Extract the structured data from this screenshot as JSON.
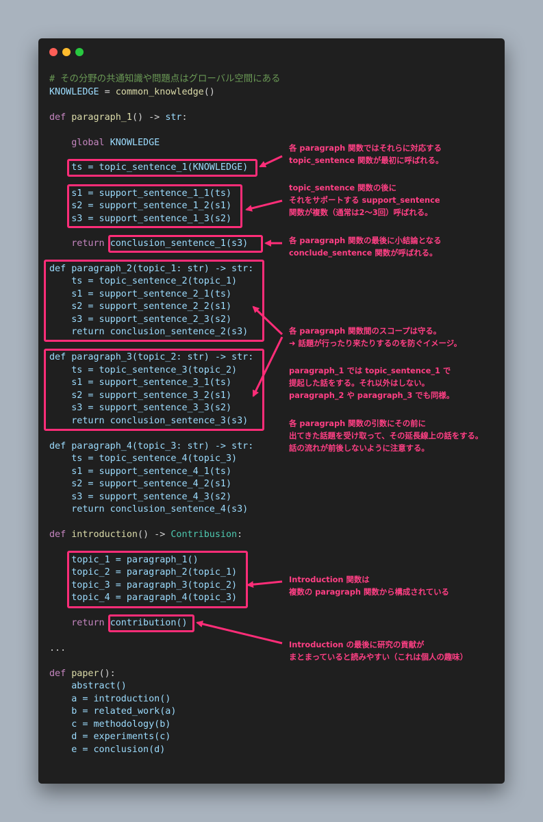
{
  "window": {
    "controls": [
      "close",
      "minimize",
      "maximize"
    ],
    "accent": "#ff2d78"
  },
  "code": {
    "comment": "# その分野の共通知識や問題点はグローバル空間にある",
    "knowledge_var": "KNOWLEDGE",
    "knowledge_fn": "common_knowledge",
    "p1_name": "paragraph_1",
    "p1_ret": "str",
    "global_kw": "global",
    "ts1": "ts = topic_sentence_1(KNOWLEDGE)",
    "s1_1": "s1 = support_sentence_1_1(ts)",
    "s1_2": "s2 = support_sentence_1_2(s1)",
    "s1_3": "s3 = support_sentence_1_3(s2)",
    "return_kw": "return",
    "c1": "conclusion_sentence_1(s3)",
    "p2_def": "def paragraph_2(topic_1: str) -> str:",
    "p2_lines": [
      "ts = topic_sentence_2(topic_1)",
      "s1 = support_sentence_2_1(ts)",
      "s2 = support_sentence_2_2(s1)",
      "s3 = support_sentence_2_3(s2)",
      "return conclusion_sentence_2(s3)"
    ],
    "p3_def": "def paragraph_3(topic_2: str) -> str:",
    "p3_lines": [
      "ts = topic_sentence_3(topic_2)",
      "s1 = support_sentence_3_1(ts)",
      "s2 = support_sentence_3_2(s1)",
      "s3 = support_sentence_3_3(s2)",
      "return conclusion_sentence_3(s3)"
    ],
    "p4_def": "def paragraph_4(topic_3: str) -> str:",
    "p4_lines": [
      "ts = topic_sentence_4(topic_3)",
      "s1 = support_sentence_4_1(ts)",
      "s2 = support_sentence_4_2(s1)",
      "s3 = support_sentence_4_3(s2)",
      "return conclusion_sentence_4(s3)"
    ],
    "intro_name": "introduction",
    "intro_type": "Contribusion",
    "intro_lines": [
      "topic_1 = paragraph_1()",
      "topic_2 = paragraph_2(topic_1)",
      "topic_3 = paragraph_3(topic_2)",
      "topic_4 = paragraph_4(topic_3)"
    ],
    "contribution": "contribution()",
    "ellipsis": "...",
    "paper_name": "paper",
    "paper_lines": [
      "abstract()",
      "a = introduction()",
      "b = related_work(a)",
      "c = methodology(b)",
      "d = experiments(c)",
      "e = conclusion(d)"
    ]
  },
  "notes": {
    "n1": [
      "各 paragraph 関数ではそれらに対応する",
      "topic_sentence 関数が最初に呼ばれる。"
    ],
    "n2": [
      "topic_sentence 関数の後に",
      "それをサポートする support_sentence",
      "関数が複数（通常は2〜3回）呼ばれる。"
    ],
    "n3": [
      "各 paragraph 関数の最後に小結論となる",
      "conclude_sentence 関数が呼ばれる。"
    ],
    "n4": [
      "各 paragraph 関数間のスコープは守る。",
      "➜ 話題が行ったり来たりするのを防ぐイメージ。"
    ],
    "n5": [
      "paragraph_1 では topic_sentence_1 で",
      "提起した話をする。それ以外はしない。",
      "paragraph_2 や paragraph_3 でも同様。"
    ],
    "n6": [
      "各 paragraph 関数の引数にその前に",
      "出てきた話題を受け取って、その延長線上の話をする。",
      "話の流れが前後しないように注意する。"
    ],
    "n7": [
      "Introduction 関数は",
      "複数の paragraph 関数から構成されている"
    ],
    "n8": [
      "Introduction の最後に研究の貢献が",
      "まとまっていると読みやすい（これは個人の趣味）"
    ]
  }
}
